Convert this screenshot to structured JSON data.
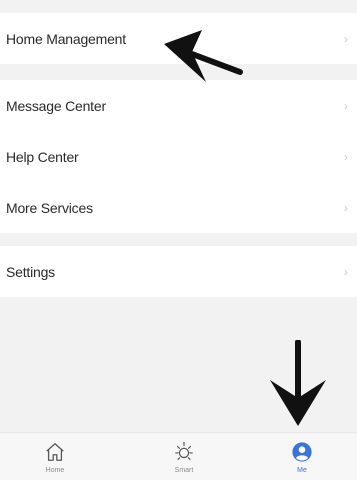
{
  "menu": {
    "group1": [
      {
        "label": "Home Management",
        "chevron": "›"
      }
    ],
    "group2": [
      {
        "label": "Message Center",
        "chevron": "›"
      },
      {
        "label": "Help Center",
        "chevron": "›"
      },
      {
        "label": "More Services",
        "chevron": "›"
      }
    ],
    "group3": [
      {
        "label": "Settings",
        "chevron": "›"
      }
    ]
  },
  "tabbar": {
    "tabs": [
      {
        "label": "Home",
        "icon": "home-icon",
        "active": false
      },
      {
        "label": "Smart",
        "icon": "sun-icon",
        "active": false
      },
      {
        "label": "Me",
        "icon": "profile-icon",
        "active": true
      }
    ]
  },
  "colors": {
    "accent": "#3b74d9",
    "background": "#f2f2f2",
    "row_background": "#ffffff",
    "tabbar_background": "#f7f7f7"
  }
}
